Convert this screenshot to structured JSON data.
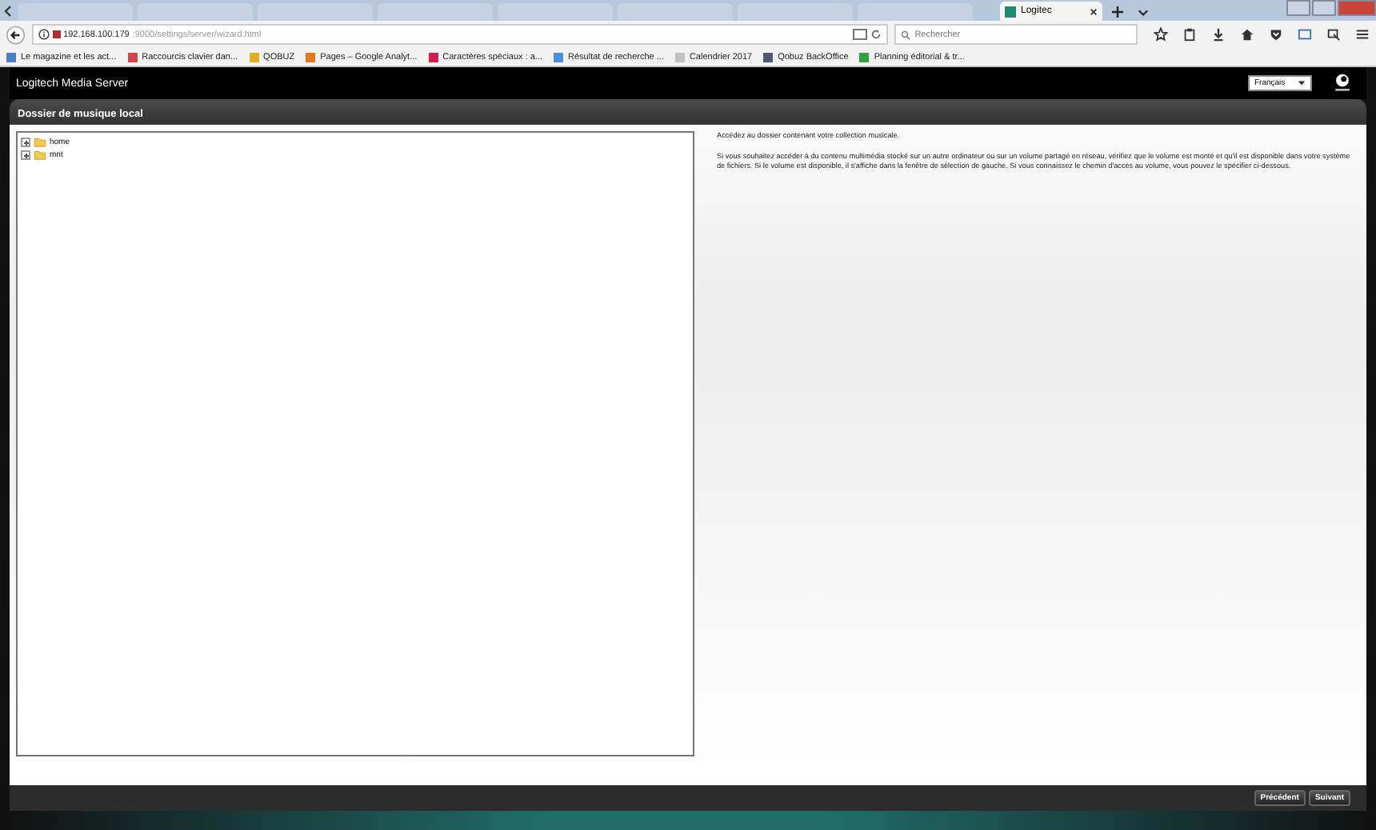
{
  "browser": {
    "tabs": [
      {
        "selected": false
      },
      {
        "selected": false
      },
      {
        "selected": false
      },
      {
        "selected": false
      },
      {
        "selected": false
      },
      {
        "selected": false
      },
      {
        "selected": false
      },
      {
        "selected": false
      },
      {
        "title": "Logitec",
        "selected": true
      }
    ],
    "url": {
      "host": "192.168.100.179",
      "path": ":9000/settings/server/wizard.html"
    },
    "search": {
      "placeholder": "Rechercher"
    },
    "bookmarks": [
      {
        "label": "Le magazine et les act..."
      },
      {
        "label": "Raccourcis clavier dan..."
      },
      {
        "label": "QOBUZ"
      },
      {
        "label": "Pages – Google Analyt..."
      },
      {
        "label": "Caractères spéciaux : a..."
      },
      {
        "label": "Résultat de recherche ..."
      },
      {
        "label": "Calendrier 2017"
      },
      {
        "label": "Qobuz BackOffice"
      },
      {
        "label": "Planning éditorial & tr..."
      }
    ]
  },
  "app": {
    "title": "Logitech Media Server",
    "language": "Français",
    "section_title": "Dossier de musique local",
    "tree": [
      {
        "label": "home",
        "expanded": false
      },
      {
        "label": "mnt",
        "expanded": false
      }
    ],
    "description": [
      "Accédez au dossier contenant votre collection musicale.",
      "Si vous souhaitez accéder à du contenu multimédia stocké sur un autre ordinateur ou sur un volume partagé en réseau, vérifiez que le volume est monté et qu'il est disponible dans votre système de fichiers. Si le volume est disponible, il s'affiche dans la fenêtre de sélection de gauche. Si vous connaissez le chemin d'accès au volume, vous pouvez le spécifier ci-dessous."
    ],
    "buttons": [
      "Précédent",
      "Suivant"
    ]
  }
}
